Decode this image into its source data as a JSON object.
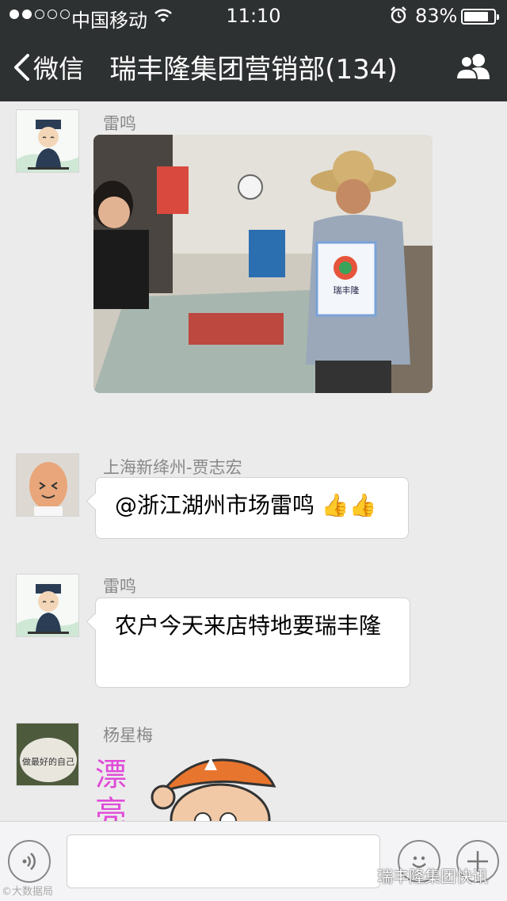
{
  "status_bar": {
    "carrier": "中国移动",
    "time": "11:10",
    "battery": "83%",
    "battery_level": 0.83
  },
  "nav": {
    "back_label": "微信",
    "title": "瑞丰隆集团营销部(134)"
  },
  "messages": [
    {
      "sender": "雷鸣",
      "type": "image"
    },
    {
      "sender": "上海新绛州-贾志宏",
      "text": "@浙江湖州市场雷鸣 👍👍"
    },
    {
      "sender": "雷鸣",
      "text": "农户今天来店特地要瑞丰隆"
    },
    {
      "sender": "杨星梅",
      "type": "sticker",
      "sticker_text": "漂亮"
    }
  ],
  "bag_label": "瑞丰隆",
  "avatar_text": "做最好的自己",
  "watermark": "瑞丰隆集团快讯",
  "watermark_left": "©大数据局"
}
